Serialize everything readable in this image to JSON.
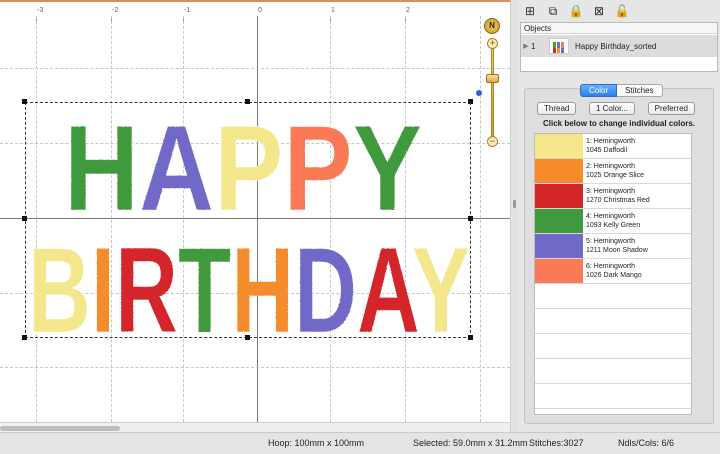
{
  "ruler": {
    "labels": [
      "-3",
      "-2",
      "-1",
      "0",
      "1",
      "2"
    ]
  },
  "zoom": {
    "compass_letter": "N",
    "plus": "+",
    "minus": "−"
  },
  "objects_panel": {
    "header": "Objects",
    "rows": [
      {
        "index": "1",
        "name": "Happy Birthday_sorted"
      }
    ]
  },
  "color_panel": {
    "tabs": [
      "Color",
      "Stitches"
    ],
    "buttons": {
      "thread": "Thread",
      "one_color": "1 Color...",
      "preferred": "Preferred"
    },
    "hint": "Click below to change individual colors.",
    "colors": [
      {
        "line1": "1: Hemingworth",
        "line2": "1045 Daffodil",
        "hex": "#f4e68a"
      },
      {
        "line1": "2: Hemingworth",
        "line2": "1025 Orange Slice",
        "hex": "#f58b2a"
      },
      {
        "line1": "3: Hemingworth",
        "line2": "1270 Christmas Red",
        "hex": "#d42629"
      },
      {
        "line1": "4: Hemingworth",
        "line2": "1093 Kelly Green",
        "hex": "#3f9a3d"
      },
      {
        "line1": "5: Hemingworth",
        "line2": "1211 Moon Shadow",
        "hex": "#7069c8"
      },
      {
        "line1": "6: Hemingworth",
        "line2": "1026 Dark Mango",
        "hex": "#fa7a57"
      }
    ]
  },
  "design": {
    "line1": "HAPPY",
    "line2": "BIRTHDAY"
  },
  "status": {
    "hoop": "Hoop: 100mm x 100mm",
    "selected": "Selected: 59.0mm x 31.2mm",
    "stitches": "Stitches:3027",
    "needles": "Ndls/Cols: 6/6"
  }
}
